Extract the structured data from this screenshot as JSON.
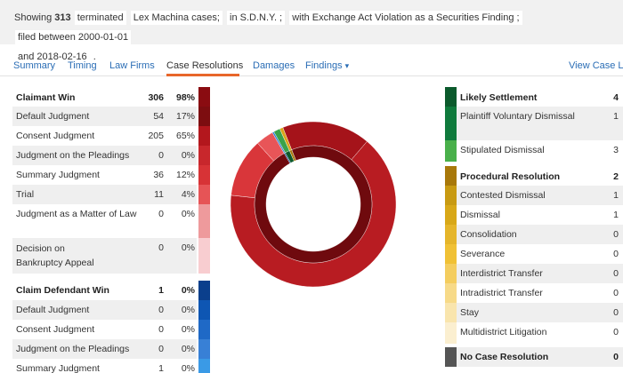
{
  "summary": {
    "showing": "Showing",
    "count": "313",
    "terminated": "terminated",
    "case_type": "Lex Machina cases;",
    "in_court": "in S.D.N.Y. ;",
    "finding": "with Exchange Act Violation as a Securities Finding ;",
    "filed_between": "filed between 2000-01-01",
    "and": "and 2018-02-16",
    "period": "."
  },
  "tabs": [
    {
      "label": "Summary"
    },
    {
      "label": "Timing"
    },
    {
      "label": "Law Firms"
    },
    {
      "label": "Case Resolutions"
    },
    {
      "label": "Damages"
    },
    {
      "label": "Findings"
    },
    {
      "label": "View Case Lis"
    }
  ],
  "findings_caret": "▾",
  "left_table": {
    "claimant": {
      "header": {
        "label": "Claimant Win",
        "count": "306",
        "pct": "98%"
      },
      "rows": [
        {
          "label": "Default Judgment",
          "count": "54",
          "pct": "17%",
          "color": "#7d0d10"
        },
        {
          "label": "Consent Judgment",
          "count": "205",
          "pct": "65%",
          "color": "#b3171d"
        },
        {
          "label": "Judgment on the Pleadings",
          "count": "0",
          "pct": "0%",
          "color": "#c8272c"
        },
        {
          "label": "Summary Judgment",
          "count": "36",
          "pct": "12%",
          "color": "#d73336"
        },
        {
          "label": "Trial",
          "count": "11",
          "pct": "4%",
          "color": "#e65456"
        },
        {
          "label": "Judgment as a Matter of Law",
          "count": "0",
          "pct": "0%",
          "color": "#ee9a9c"
        },
        {
          "label": "Decision on Bankruptcy Appeal",
          "count": "0",
          "pct": "0%",
          "color": "#f8cdd0"
        }
      ],
      "header_color": "#8a0c11"
    },
    "defendant": {
      "header": {
        "label": "Claim Defendant Win",
        "count": "1",
        "pct": "0%"
      },
      "rows": [
        {
          "label": "Default Judgment",
          "count": "0",
          "pct": "0%",
          "color": "#0e56b3"
        },
        {
          "label": "Consent Judgment",
          "count": "0",
          "pct": "0%",
          "color": "#1f69c6"
        },
        {
          "label": "Judgment on the Pleadings",
          "count": "0",
          "pct": "0%",
          "color": "#3880d6"
        },
        {
          "label": "Summary Judgment",
          "count": "1",
          "pct": "0%",
          "color": "#3a9ae6"
        }
      ],
      "header_color": "#0b3f8c"
    }
  },
  "right_table": {
    "settlement": {
      "header": {
        "label": "Likely Settlement",
        "count": "4"
      },
      "rows": [
        {
          "label": "Plaintiff Voluntary Dismissal",
          "count": "1",
          "color": "#0f7a3c"
        },
        {
          "label": "Stipulated Dismissal",
          "count": "3",
          "color": "#49b04a"
        }
      ],
      "header_color": "#0b5a2c"
    },
    "procedural": {
      "header": {
        "label": "Procedural Resolution",
        "count": "2"
      },
      "rows": [
        {
          "label": "Contested Dismissal",
          "count": "1",
          "color": "#c89a12"
        },
        {
          "label": "Dismissal",
          "count": "1",
          "color": "#d8a818"
        },
        {
          "label": "Consolidation",
          "count": "0",
          "color": "#e5b52a"
        },
        {
          "label": "Severance",
          "count": "0",
          "color": "#f0c135"
        },
        {
          "label": "Interdistrict Transfer",
          "count": "0",
          "color": "#f4cd5e"
        },
        {
          "label": "Intradistrict Transfer",
          "count": "0",
          "color": "#f7da88"
        },
        {
          "label": "Stay",
          "count": "0",
          "color": "#f9e5ad"
        },
        {
          "label": "Multidistrict Litigation",
          "count": "0",
          "color": "#fbefd0"
        }
      ],
      "header_color": "#a8780a"
    },
    "no_resolution": {
      "header": {
        "label": "No Case Resolution",
        "count": "0"
      },
      "header_color": "#555555"
    }
  },
  "chart_data": {
    "type": "pie",
    "outer_ring": [
      {
        "name": "Default Judgment",
        "value": 54,
        "color": "#a5131a"
      },
      {
        "name": "Consent Judgment",
        "value": 205,
        "color": "#b81c22"
      },
      {
        "name": "Summary Judgment",
        "value": 36,
        "color": "#d9363a"
      },
      {
        "name": "Trial",
        "value": 11,
        "color": "#e85558"
      },
      {
        "name": "Claim Defendant Win",
        "value": 1,
        "color": "#2c7fd6"
      },
      {
        "name": "Likely Settlement",
        "value": 4,
        "color": "#3aa24a"
      },
      {
        "name": "Procedural Resolution",
        "value": 2,
        "color": "#d9a519"
      }
    ],
    "inner_ring": [
      {
        "name": "Claimant Win",
        "value": 306,
        "color": "#6f0a0e"
      },
      {
        "name": "Claim Defendant Win",
        "value": 1,
        "color": "#0b3f8c"
      },
      {
        "name": "Likely Settlement",
        "value": 4,
        "color": "#0b5a2c"
      },
      {
        "name": "Procedural Resolution",
        "value": 2,
        "color": "#a8780a"
      }
    ]
  }
}
